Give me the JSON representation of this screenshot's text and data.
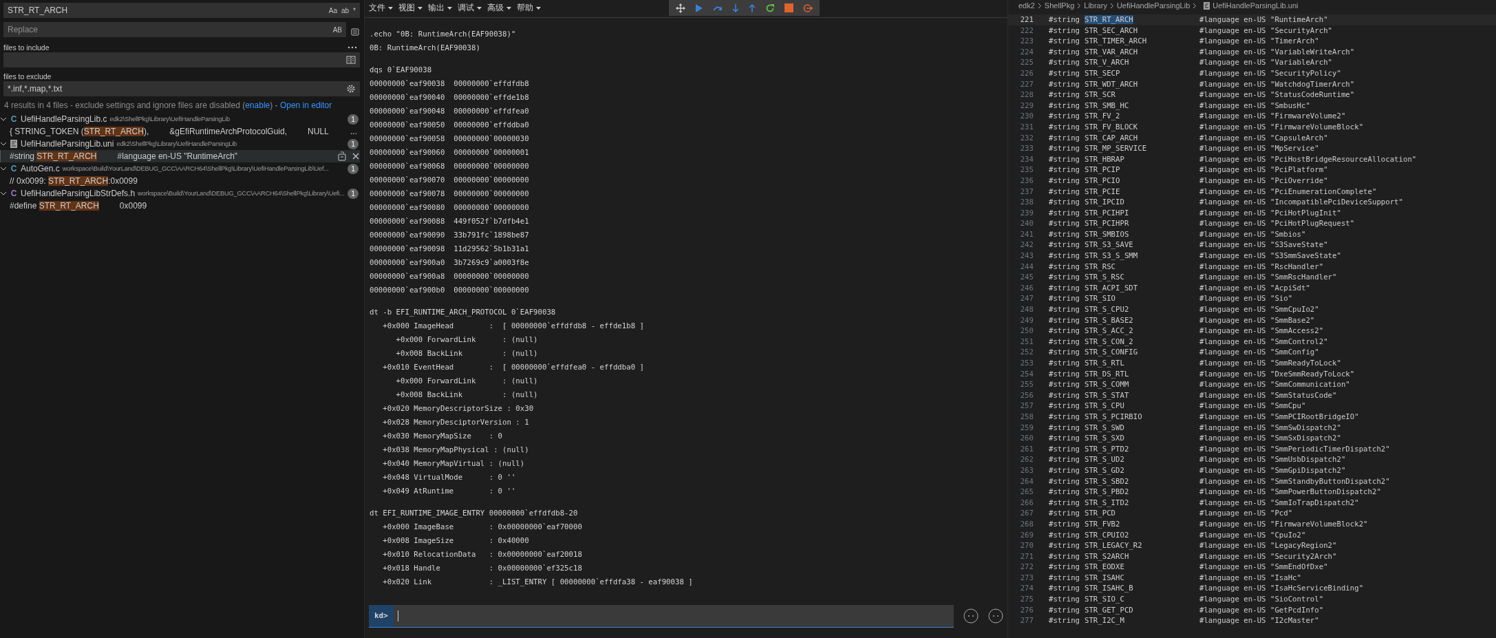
{
  "search": {
    "find": {
      "value": "STR_RT_ARCH",
      "toggles": [
        "Aa",
        "ab",
        "*"
      ]
    },
    "replace": {
      "placeholder": "Replace",
      "toggle": "AB"
    },
    "include": {
      "label": "files to include"
    },
    "exclude": {
      "label": "files to exclude",
      "value": "*.inf,*.map,*.txt"
    },
    "summary": {
      "text": "4 results in 4 files - exclude settings and ignore files are disabled (",
      "link": "enable",
      "after": ") - ",
      "open": "Open in editor"
    },
    "results": [
      {
        "kind": "c",
        "icon": "C",
        "color": "#519aba",
        "file": "UefiHandleParsingLib.c",
        "path": "edk2\\ShellPkg\\Library\\UefiHandleParsingLib",
        "count": "1",
        "expanded": true,
        "matches": [
          {
            "before": "{ STRING_TOKEN (",
            "match": "STR_RT_ARCH",
            "after": "),",
            "extra": [
              "&gEfiRuntimeArchProtocolGuid,",
              "NULL"
            ],
            "more": "...",
            "selected": false
          }
        ]
      },
      {
        "kind": "doc",
        "color": "#a0a0a0",
        "file": "UefiHandleParsingLib.uni",
        "path": "edk2\\ShellPkg\\Library\\UefiHandleParsingLib",
        "count": "1",
        "expanded": true,
        "matches": [
          {
            "before": "#string ",
            "match": "STR_RT_ARCH",
            "extra": [
              "#language en-US \"RuntimeArch\""
            ],
            "selected": true
          }
        ]
      },
      {
        "kind": "c",
        "icon": "C",
        "color": "#519aba",
        "file": "AutoGen.c",
        "path": "workspace\\Build\\YourLand\\DEBUG_GCC\\AARCH64\\ShellPkg\\Library\\UefiHandleParsingLib\\Uef...",
        "count": "1",
        "expanded": true,
        "matches": [
          {
            "before": "// 0x0099: ",
            "match": "STR_RT_ARCH",
            "after": ":0x0099",
            "selected": false
          }
        ]
      },
      {
        "kind": "c",
        "icon": "C",
        "color": "#a074c4",
        "file": "UefiHandleParsingLibStrDefs.h",
        "path": "workspace\\Build\\YourLand\\DEBUG_GCC\\AARCH64\\ShellPkg\\Library\\Uefi...",
        "count": "1",
        "expanded": true,
        "matches": [
          {
            "before": "#define ",
            "match": "STR_RT_ARCH",
            "extra": [
              "0x0099"
            ],
            "selected": false
          }
        ]
      }
    ]
  },
  "debugger": {
    "menu": [
      "文件",
      "视图",
      "输出",
      "调试",
      "高级",
      "帮助"
    ],
    "toolbar": [
      {
        "kind": "move",
        "color": "#d0d0d0"
      },
      {
        "kind": "go",
        "color": "#3a7fd5"
      },
      {
        "kind": "step-over",
        "color": "#3a7fd5"
      },
      {
        "kind": "step-into",
        "color": "#3a7fd5"
      },
      {
        "kind": "step-out",
        "color": "#3a7fd5"
      },
      {
        "kind": "restart",
        "color": "#5fbf4a"
      },
      {
        "kind": "stop",
        "color": "#e0622c"
      },
      {
        "kind": "detach",
        "color": "#e0622c"
      }
    ],
    "output": [
      [
        ".echo \"0B: RuntimeArch(EAF90038)\"",
        "0B: RuntimeArch(EAF90038)"
      ],
      [
        "dqs 0`EAF90038",
        "00000000`eaf90038  00000000`effdfdb8",
        "00000000`eaf90040  00000000`effde1b8",
        "00000000`eaf90048  00000000`effdfea0",
        "00000000`eaf90050  00000000`effddba0",
        "00000000`eaf90058  00000000`00000030",
        "00000000`eaf90060  00000000`00000001",
        "00000000`eaf90068  00000000`00000000",
        "00000000`eaf90070  00000000`00000000",
        "00000000`eaf90078  00000000`00000000",
        "00000000`eaf90080  00000000`00000000",
        "00000000`eaf90088  449f052f`b7dfb4e1",
        "00000000`eaf90090  33b791fc`1898be87",
        "00000000`eaf90098  11d29562`5b1b31a1",
        "00000000`eaf900a0  3b7269c9`a0003f8e",
        "00000000`eaf900a8  00000000`00000000",
        "00000000`eaf900b0  00000000`00000000"
      ],
      [
        "dt -b EFI_RUNTIME_ARCH_PROTOCOL 0`EAF90038",
        "   +0x000 ImageHead        :  [ 00000000`effdfdb8 - effde1b8 ]",
        "      +0x000 ForwardLink      : (null)",
        "      +0x008 BackLink         : (null)",
        "   +0x010 EventHead        :  [ 00000000`effdfea0 - effddba0 ]",
        "      +0x000 ForwardLink      : (null)",
        "      +0x008 BackLink         : (null)",
        "   +0x020 MemoryDescriptorSize : 0x30",
        "   +0x028 MemoryDesciptorVersion : 1",
        "   +0x030 MemoryMapSize    : 0",
        "   +0x038 MemoryMapPhysical : (null)",
        "   +0x040 MemoryMapVirtual : (null)",
        "   +0x048 VirtualMode      : 0 ''",
        "   +0x049 AtRuntime        : 0 ''"
      ],
      [
        "dt EFI_RUNTIME_IMAGE_ENTRY 00000000`effdfdb8-20",
        "   +0x000 ImageBase        : 0x00000000`eaf70000",
        "   +0x008 ImageSize        : 0x40000",
        "   +0x010 RelocationData   : 0x00000000`eaf20018",
        "   +0x018 Handle           : 0x00000000`ef325c18",
        "   +0x020 Link             : _LIST_ENTRY [ 00000000`effdfa38 - eaf90038 ]"
      ]
    ],
    "prompt": "kd>"
  },
  "editor": {
    "breadcrumb": [
      "edk2",
      "ShellPkg",
      "Library",
      "UefiHandleParsingLib",
      "UefiHandleParsingLib.uni"
    ],
    "lines": [
      {
        "num": "221",
        "kw": "#string",
        "name": "STR_RT_ARCH",
        "right": "#language en-US \"RuntimeArch\"",
        "selected": true
      },
      {
        "num": "222",
        "kw": "#string",
        "name": "STR_SEC_ARCH",
        "right": "#language en-US \"SecurityArch\"",
        "selected": false
      },
      {
        "num": "223",
        "kw": "#string",
        "name": "STR_TIMER_ARCH",
        "right": "#language en-US \"TimerArch\"",
        "selected": false
      },
      {
        "num": "224",
        "kw": "#string",
        "name": "STR_VAR_ARCH",
        "right": "#language en-US \"VariableWriteArch\"",
        "selected": false
      },
      {
        "num": "225",
        "kw": "#string",
        "name": "STR_V_ARCH",
        "right": "#language en-US \"VariableArch\"",
        "selected": false
      },
      {
        "num": "226",
        "kw": "#string",
        "name": "STR_SECP",
        "right": "#language en-US \"SecurityPolicy\"",
        "selected": false
      },
      {
        "num": "227",
        "kw": "#string",
        "name": "STR_WDT_ARCH",
        "right": "#language en-US \"WatchdogTimerArch\"",
        "selected": false
      },
      {
        "num": "228",
        "kw": "#string",
        "name": "STR_SCR",
        "right": "#language en-US \"StatusCodeRuntime\"",
        "selected": false
      },
      {
        "num": "229",
        "kw": "#string",
        "name": "STR_SMB_HC",
        "right": "#language en-US \"SmbusHc\"",
        "selected": false
      },
      {
        "num": "230",
        "kw": "#string",
        "name": "STR_FV_2",
        "right": "#language en-US \"FirmwareVolume2\"",
        "selected": false
      },
      {
        "num": "231",
        "kw": "#string",
        "name": "STR_FV_BLOCK",
        "right": "#language en-US \"FirmwareVolumeBlock\"",
        "selected": false
      },
      {
        "num": "232",
        "kw": "#string",
        "name": "STR_CAP_ARCH",
        "right": "#language en-US \"CapsuleArch\"",
        "selected": false
      },
      {
        "num": "233",
        "kw": "#string",
        "name": "STR_MP_SERVICE",
        "right": "#language en-US \"MpService\"",
        "selected": false
      },
      {
        "num": "234",
        "kw": "#string",
        "name": "STR_HBRAP",
        "right": "#language en-US \"PciHostBridgeResourceAllocation\"",
        "selected": false
      },
      {
        "num": "235",
        "kw": "#string",
        "name": "STR_PCIP",
        "right": "#language en-US \"PciPlatform\"",
        "selected": false
      },
      {
        "num": "236",
        "kw": "#string",
        "name": "STR_PCIO",
        "right": "#language en-US \"PciOverride\"",
        "selected": false
      },
      {
        "num": "237",
        "kw": "#string",
        "name": "STR_PCIE",
        "right": "#language en-US \"PciEnumerationComplete\"",
        "selected": false
      },
      {
        "num": "238",
        "kw": "#string",
        "name": "STR_IPCID",
        "right": "#language en-US \"IncompatiblePciDeviceSupport\"",
        "selected": false
      },
      {
        "num": "239",
        "kw": "#string",
        "name": "STR_PCIHPI",
        "right": "#language en-US \"PciHotPlugInit\"",
        "selected": false
      },
      {
        "num": "240",
        "kw": "#string",
        "name": "STR_PCIHPR",
        "right": "#language en-US \"PciHotPlugRequest\"",
        "selected": false
      },
      {
        "num": "241",
        "kw": "#string",
        "name": "STR_SMBIOS",
        "right": "#language en-US \"Smbios\"",
        "selected": false
      },
      {
        "num": "242",
        "kw": "#string",
        "name": "STR_S3_SAVE",
        "right": "#language en-US \"S3SaveState\"",
        "selected": false
      },
      {
        "num": "243",
        "kw": "#string",
        "name": "STR_S3_S_SMM",
        "right": "#language en-US \"S3SmmSaveState\"",
        "selected": false
      },
      {
        "num": "244",
        "kw": "#string",
        "name": "STR_RSC",
        "right": "#language en-US \"RscHandler\"",
        "selected": false
      },
      {
        "num": "245",
        "kw": "#string",
        "name": "STR_S_RSC",
        "right": "#language en-US \"SmmRscHandler\"",
        "selected": false
      },
      {
        "num": "246",
        "kw": "#string",
        "name": "STR_ACPI_SDT",
        "right": "#language en-US \"AcpiSdt\"",
        "selected": false
      },
      {
        "num": "247",
        "kw": "#string",
        "name": "STR_SIO",
        "right": "#language en-US \"Sio\"",
        "selected": false
      },
      {
        "num": "248",
        "kw": "#string",
        "name": "STR_S_CPU2",
        "right": "#language en-US \"SmmCpuIo2\"",
        "selected": false
      },
      {
        "num": "249",
        "kw": "#string",
        "name": "STR_S_BASE2",
        "right": "#language en-US \"SmmBase2\"",
        "selected": false
      },
      {
        "num": "250",
        "kw": "#string",
        "name": "STR_S_ACC_2",
        "right": "#language en-US \"SmmAccess2\"",
        "selected": false
      },
      {
        "num": "251",
        "kw": "#string",
        "name": "STR_S_CON_2",
        "right": "#language en-US \"SmmControl2\"",
        "selected": false
      },
      {
        "num": "252",
        "kw": "#string",
        "name": "STR_S_CONFIG",
        "right": "#language en-US \"SmmConfig\"",
        "selected": false
      },
      {
        "num": "253",
        "kw": "#string",
        "name": "STR_S_RTL",
        "right": "#language en-US \"SmmReadyToLock\"",
        "selected": false
      },
      {
        "num": "254",
        "kw": "#string",
        "name": "STR_DS_RTL",
        "right": "#language en-US \"DxeSmmReadyToLock\"",
        "selected": false
      },
      {
        "num": "255",
        "kw": "#string",
        "name": "STR_S_COMM",
        "right": "#language en-US \"SmmCommunication\"",
        "selected": false
      },
      {
        "num": "256",
        "kw": "#string",
        "name": "STR_S_STAT",
        "right": "#language en-US \"SmmStatusCode\"",
        "selected": false
      },
      {
        "num": "257",
        "kw": "#string",
        "name": "STR_S_CPU",
        "right": "#language en-US \"SmmCpu\"",
        "selected": false
      },
      {
        "num": "258",
        "kw": "#string",
        "name": "STR_S_PCIRBIO",
        "right": "#language en-US \"SmmPCIRootBridgeIO\"",
        "selected": false
      },
      {
        "num": "259",
        "kw": "#string",
        "name": "STR_S_SWD",
        "right": "#language en-US \"SmmSwDispatch2\"",
        "selected": false
      },
      {
        "num": "260",
        "kw": "#string",
        "name": "STR_S_SXD",
        "right": "#language en-US \"SmmSxDispatch2\"",
        "selected": false
      },
      {
        "num": "261",
        "kw": "#string",
        "name": "STR_S_PTD2",
        "right": "#language en-US \"SmmPeriodicTimerDispatch2\"",
        "selected": false
      },
      {
        "num": "262",
        "kw": "#string",
        "name": "STR_S_UD2",
        "right": "#language en-US \"SmmUsbDispatch2\"",
        "selected": false
      },
      {
        "num": "263",
        "kw": "#string",
        "name": "STR_S_GD2",
        "right": "#language en-US \"SmmGpiDispatch2\"",
        "selected": false
      },
      {
        "num": "264",
        "kw": "#string",
        "name": "STR_S_SBD2",
        "right": "#language en-US \"SmmStandbyButtonDispatch2\"",
        "selected": false
      },
      {
        "num": "265",
        "kw": "#string",
        "name": "STR_S_PBD2",
        "right": "#language en-US \"SmmPowerButtonDispatch2\"",
        "selected": false
      },
      {
        "num": "266",
        "kw": "#string",
        "name": "STR_S_ITD2",
        "right": "#language en-US \"SmmIoTrapDispatch2\"",
        "selected": false
      },
      {
        "num": "267",
        "kw": "#string",
        "name": "STR_PCD",
        "right": "#language en-US \"Pcd\"",
        "selected": false
      },
      {
        "num": "268",
        "kw": "#string",
        "name": "STR_FVB2",
        "right": "#language en-US \"FirmwareVolumeBlock2\"",
        "selected": false
      },
      {
        "num": "269",
        "kw": "#string",
        "name": "STR_CPUIO2",
        "right": "#language en-US \"CpuIo2\"",
        "selected": false
      },
      {
        "num": "270",
        "kw": "#string",
        "name": "STR_LEGACY_R2",
        "right": "#language en-US \"LegacyRegion2\"",
        "selected": false
      },
      {
        "num": "271",
        "kw": "#string",
        "name": "STR_S2ARCH",
        "right": "#language en-US \"Security2Arch\"",
        "selected": false
      },
      {
        "num": "272",
        "kw": "#string",
        "name": "STR_EODXE",
        "right": "#language en-US \"SmmEndOfDxe\"",
        "selected": false
      },
      {
        "num": "273",
        "kw": "#string",
        "name": "STR_ISAHC",
        "right": "#language en-US \"IsaHc\"",
        "selected": false
      },
      {
        "num": "274",
        "kw": "#string",
        "name": "STR_ISAHC_B",
        "right": "#language en-US \"IsaHcServiceBinding\"",
        "selected": false
      },
      {
        "num": "275",
        "kw": "#string",
        "name": "STR_SIO_C",
        "right": "#language en-US \"SioControl\"",
        "selected": false
      },
      {
        "num": "276",
        "kw": "#string",
        "name": "STR_GET_PCD",
        "right": "#language en-US \"GetPcdInfo\"",
        "selected": false
      },
      {
        "num": "277",
        "kw": "#string",
        "name": "STR_I2C_M",
        "right": "#language en-US \"I2cMaster\"",
        "selected": false
      }
    ]
  }
}
